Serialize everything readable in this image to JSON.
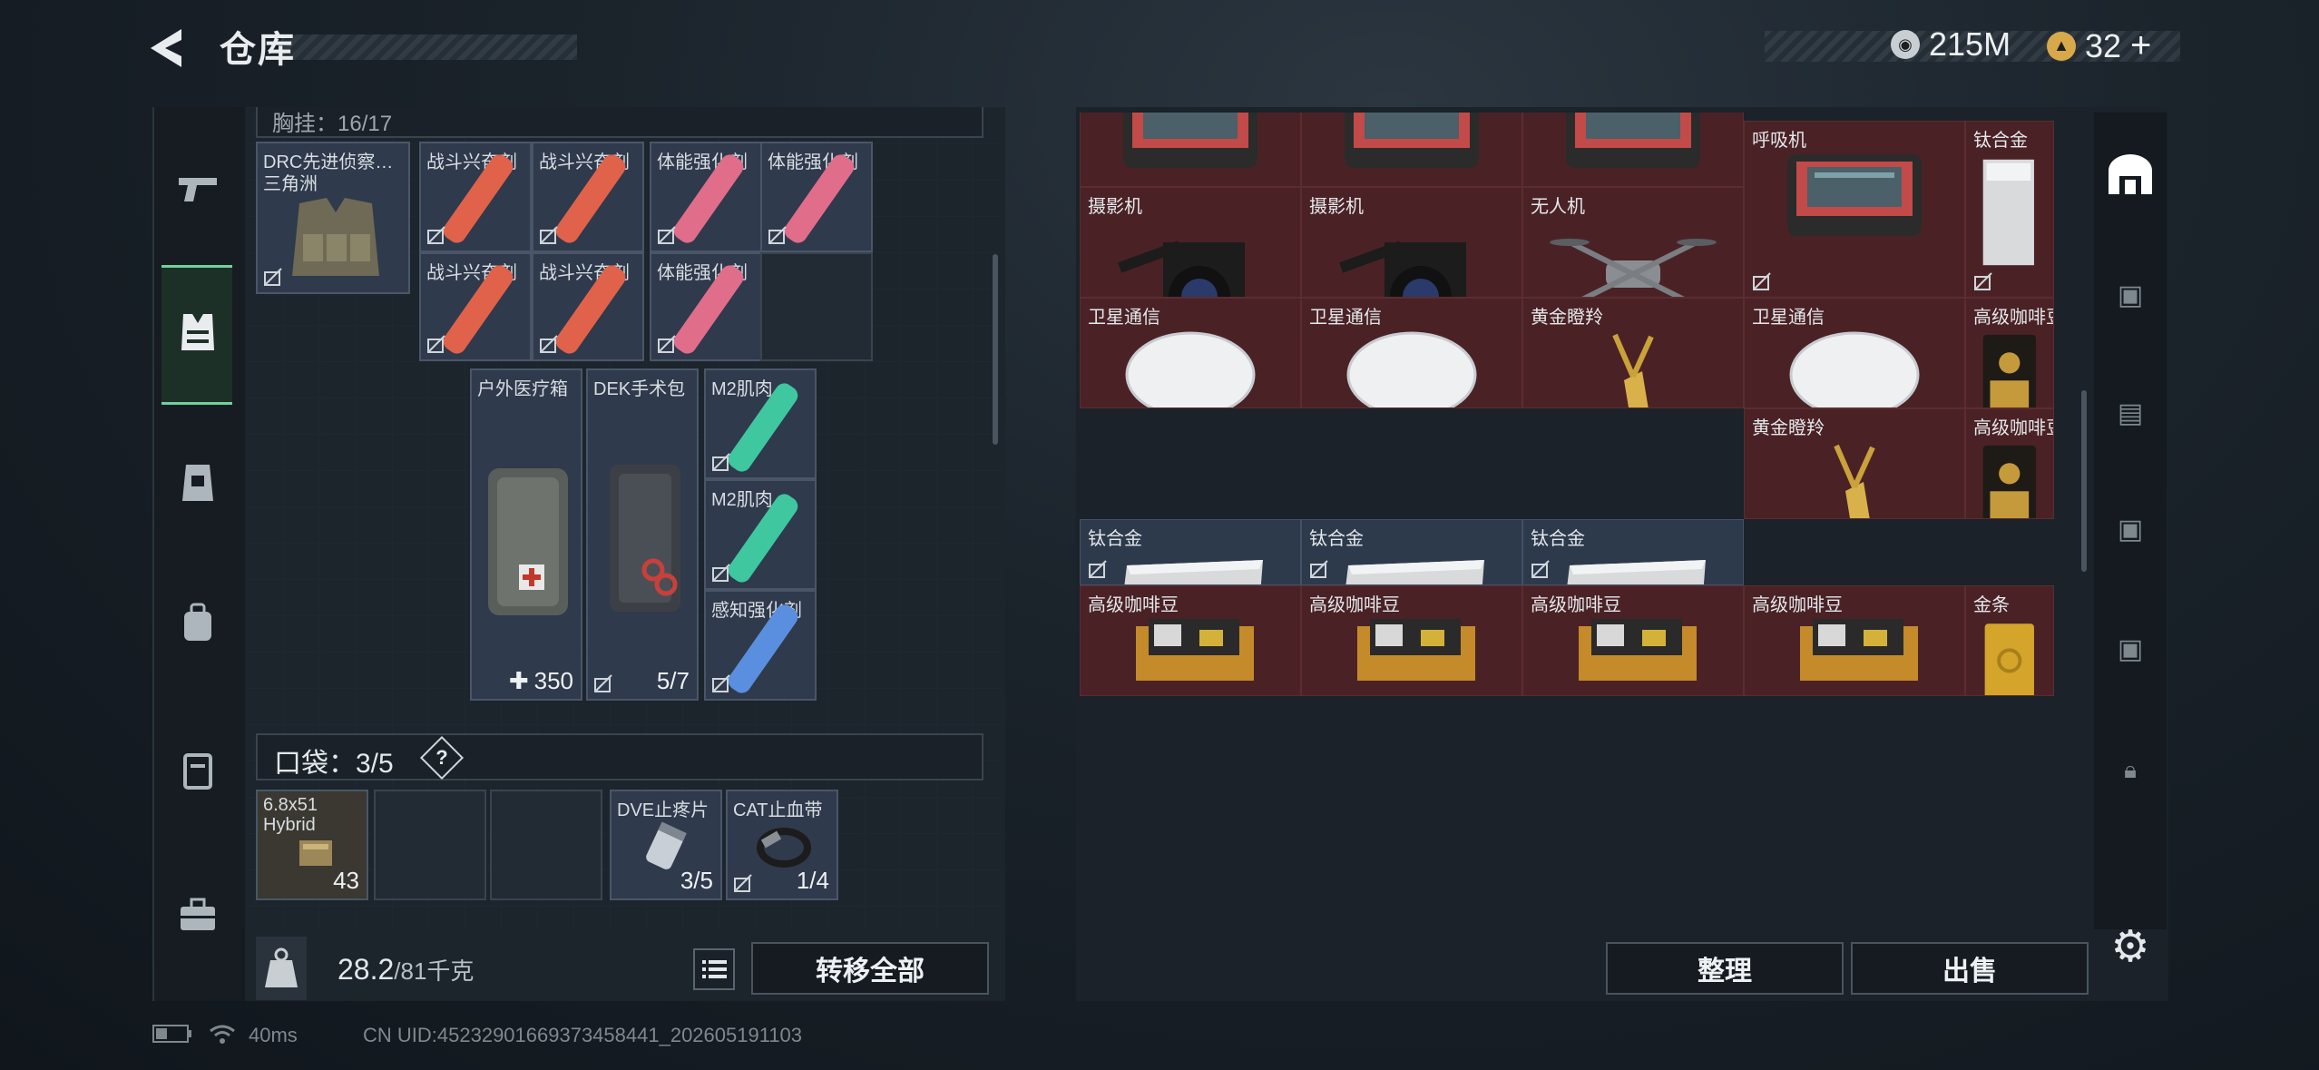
{
  "header": {
    "title": "仓库",
    "currency": [
      {
        "icon": "silver-coin-icon",
        "value": "215M"
      },
      {
        "icon": "gold-coin-icon",
        "value": "32"
      }
    ]
  },
  "left": {
    "top_bar_text": "胸挂：16/17",
    "rig": {
      "name": "DRC先进侦察…",
      "sub": "三角洲"
    },
    "rig_items": [
      {
        "name": "战斗兴奋剂",
        "color": "#e0624a"
      },
      {
        "name": "战斗兴奋剂",
        "color": "#e0624a"
      },
      {
        "name": "体能强化剂",
        "color": "#e06d8a"
      },
      {
        "name": "体能强化剂",
        "color": "#e06d8a"
      },
      {
        "name": "战斗兴奋剂",
        "color": "#e0624a"
      },
      {
        "name": "战斗兴奋剂",
        "color": "#e0624a"
      },
      {
        "name": "体能强化剂",
        "color": "#e06d8a"
      }
    ],
    "medical": [
      {
        "name": "户外医疗箱",
        "qty": "350"
      },
      {
        "name": "DEK手术包",
        "qty": "5/7"
      }
    ],
    "injectors": [
      {
        "name": "M2肌肉…",
        "color": "#3fc7a0"
      },
      {
        "name": "M2肌肉…",
        "color": "#3fc7a0"
      },
      {
        "name": "感知强化剂",
        "color": "#5a8fe0"
      }
    ],
    "pocket": {
      "label": "口袋：3/5",
      "help": "?"
    },
    "pocket_items": [
      {
        "name": "6.8x51",
        "sub": "Hybrid",
        "qty": "43"
      },
      {
        "name": "",
        "qty": ""
      },
      {
        "name": "",
        "qty": ""
      },
      {
        "name": "DVE止疼片",
        "qty": "3/5"
      },
      {
        "name": "CAT止血带",
        "qty": "1/4"
      }
    ],
    "weight": {
      "current": "28.2",
      "max": "/81千克"
    },
    "transfer_all": "转移全部"
  },
  "right": {
    "cells": [
      {
        "name": "",
        "kind": "breather"
      },
      {
        "name": "",
        "kind": "breather"
      },
      {
        "name": "",
        "kind": "breather"
      },
      {
        "name": "摄影机",
        "kind": "camera"
      },
      {
        "name": "摄影机",
        "kind": "camera"
      },
      {
        "name": "无人机",
        "kind": "drone"
      },
      {
        "name": "呼吸机",
        "kind": "breather"
      },
      {
        "name": "钛合金",
        "kind": "ingot"
      },
      {
        "name": "卫星通信",
        "kind": "dish"
      },
      {
        "name": "卫星通信",
        "kind": "dish"
      },
      {
        "name": "黄金瞪羚",
        "kind": "deer"
      },
      {
        "name": "卫星通信",
        "kind": "dish"
      },
      {
        "name": "高级咖啡豆",
        "kind": "coffee"
      },
      {
        "name": "黄金瞪羚",
        "kind": "deer"
      },
      {
        "name": "高级咖啡豆",
        "kind": "coffee"
      },
      {
        "name": "钛合金",
        "kind": "ingot"
      },
      {
        "name": "钛合金",
        "kind": "ingot"
      },
      {
        "name": "钛合金",
        "kind": "ingot"
      },
      {
        "name": "高级咖啡豆",
        "kind": "coffeebox"
      },
      {
        "name": "高级咖啡豆",
        "kind": "coffeebox"
      },
      {
        "name": "高级咖啡豆",
        "kind": "coffeebox"
      },
      {
        "name": "高级咖啡豆",
        "kind": "coffeebox"
      },
      {
        "name": "金条",
        "kind": "goldbar"
      }
    ],
    "sort_button": "整理",
    "sell_button": "出售"
  },
  "status": {
    "ping": "40ms",
    "uid": "CN UID:4523290166937345844​1_202605191103"
  },
  "colors": {
    "accent_green": "#6fd29a",
    "valuable_red": "#4a2226",
    "item_blue": "#2f3a4c"
  }
}
